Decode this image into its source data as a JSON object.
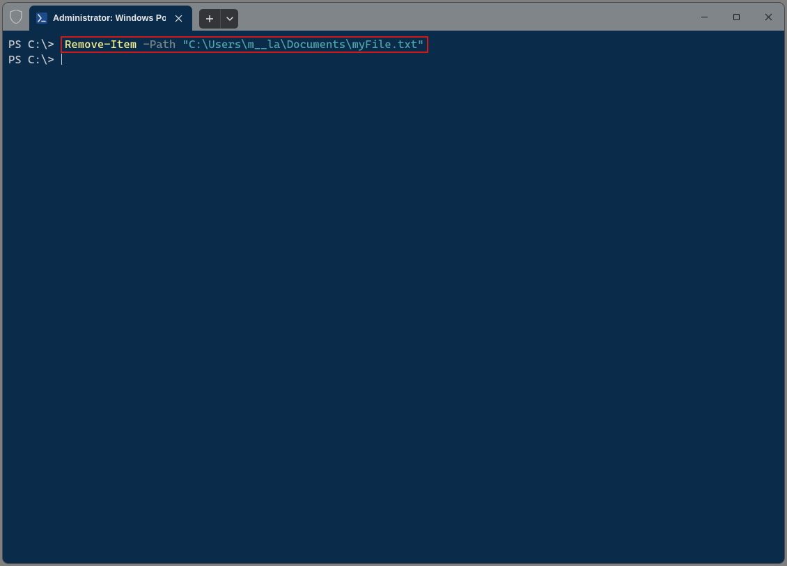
{
  "window": {
    "tab_title": "Administrator: Windows Powe",
    "newtab_plus": "+",
    "newtab_chevron": "⌄"
  },
  "terminal": {
    "lines": [
      {
        "prompt": "PS C:\\>",
        "cmd": "Remove-Item",
        "param": "-Path",
        "str": "\"C:\\Users\\m__la\\Documents\\myFile.txt\"",
        "highlight": true
      },
      {
        "prompt": "PS C:\\>",
        "cursor": true
      }
    ]
  },
  "colors": {
    "terminal_bg": "#0b2b4a",
    "prompt": "#c9cccd",
    "cmd": "#f5f191",
    "param": "#7b8b8d",
    "string": "#4fa6a8",
    "highlight_border": "#d11a1a"
  }
}
